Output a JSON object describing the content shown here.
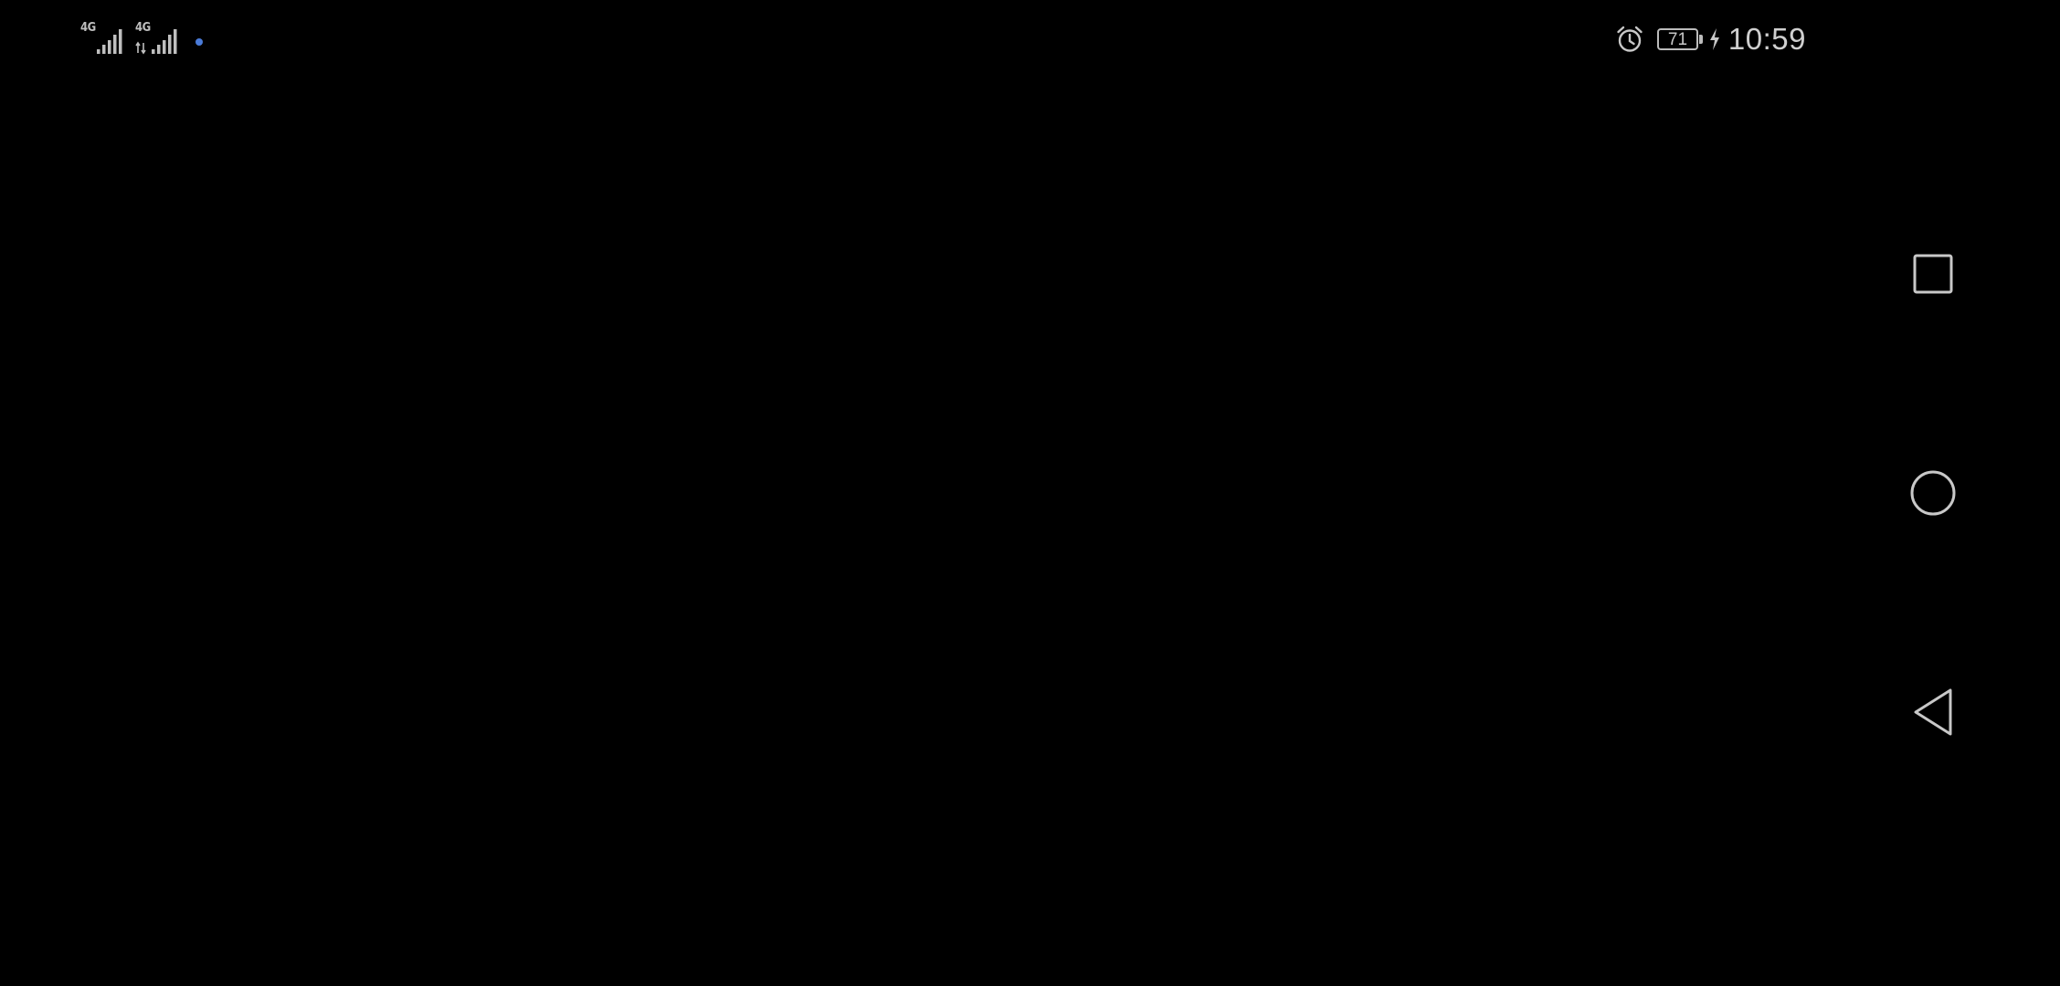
{
  "status_bar": {
    "sim1": {
      "network": "4G",
      "signal_icon": "signal-bars-icon"
    },
    "sim2": {
      "network": "4G",
      "signal_icon": "signal-bars-icon"
    },
    "notification_dot_color": "#4a7bd8",
    "alarm_icon": "alarm-clock-icon",
    "battery_level": "71",
    "charging_icon": "lightning-bolt-icon",
    "time": "10:59"
  },
  "navigation_bar": {
    "recents_icon": "square-icon",
    "home_icon": "circle-icon",
    "back_icon": "triangle-back-icon"
  },
  "colors": {
    "background": "#000000",
    "icon_stroke": "#c8c8c8",
    "accent_dot": "#4a7bd8"
  }
}
